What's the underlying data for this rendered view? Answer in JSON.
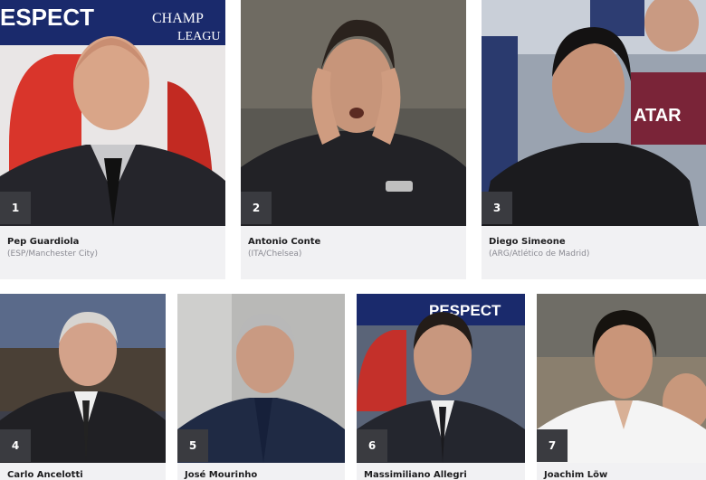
{
  "coaches": [
    {
      "rank": "1",
      "name": "Pep Guardiola",
      "club": "(ESP/Manchester City)"
    },
    {
      "rank": "2",
      "name": "Antonio Conte",
      "club": "(ITA/Chelsea)"
    },
    {
      "rank": "3",
      "name": "Diego Simeone",
      "club": "(ARG/Atlético de Madrid)"
    },
    {
      "rank": "4",
      "name": "Carlo Ancelotti",
      "club": ""
    },
    {
      "rank": "5",
      "name": "José Mourinho",
      "club": ""
    },
    {
      "rank": "6",
      "name": "Massimiliano Allegri",
      "club": ""
    },
    {
      "rank": "7",
      "name": "Joachim Löw",
      "club": ""
    }
  ],
  "banners": {
    "card1_left": "ESPECT",
    "card1_right_top": "CHAMP",
    "card1_right_bottom": "LEAGU",
    "card3": "ATAR",
    "card6": "PESPECT"
  },
  "colors": {
    "card_bg": "#f1f1f3",
    "rank_badge": "#3a3b40",
    "name_text": "#1d1d1f",
    "club_text": "#8a8a92",
    "uefa_blue": "#1a2a6c"
  }
}
